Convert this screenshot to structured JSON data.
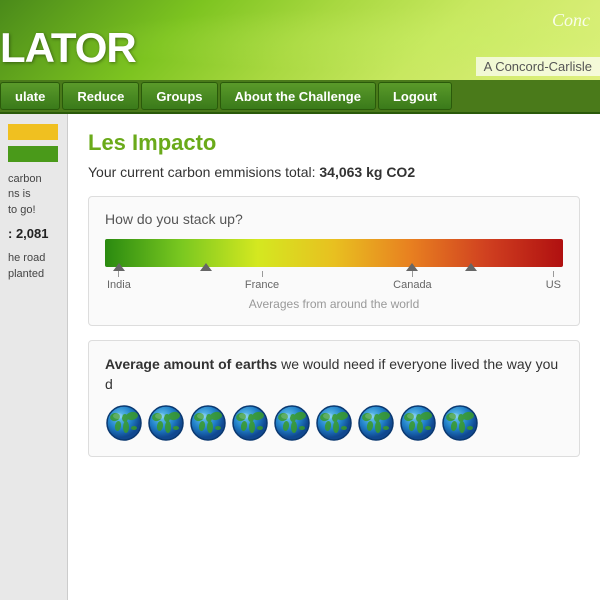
{
  "header": {
    "title": "LATOR",
    "brand": "Conc",
    "subtitle": "A Concord-Carlisle"
  },
  "navbar": {
    "items": [
      {
        "label": "ulate",
        "id": "calculate"
      },
      {
        "label": "Reduce",
        "id": "reduce"
      },
      {
        "label": "Groups",
        "id": "groups"
      },
      {
        "label": "About the Challenge",
        "id": "about"
      },
      {
        "label": "Logout",
        "id": "logout"
      }
    ]
  },
  "sidebar": {
    "bar_label": "",
    "text1": "carbon",
    "text2": "ns is",
    "text3": "to go!",
    "number_label": ": 2,081",
    "text4": "he road",
    "text5": "planted"
  },
  "main": {
    "page_title": "Les Impacto",
    "carbon_summary_prefix": "Your current carbon emmisions total: ",
    "carbon_value": "34,063 kg CO2",
    "stack_section": {
      "title": "How do you stack up?",
      "labels": [
        "India",
        "France",
        "Canada",
        "US"
      ],
      "averages_text": "Averages from around the world"
    },
    "earths_section": {
      "title_prefix": "Average amount of earths",
      "title_suffix": " we would need if everyone lived the way you d",
      "count": 9
    }
  }
}
